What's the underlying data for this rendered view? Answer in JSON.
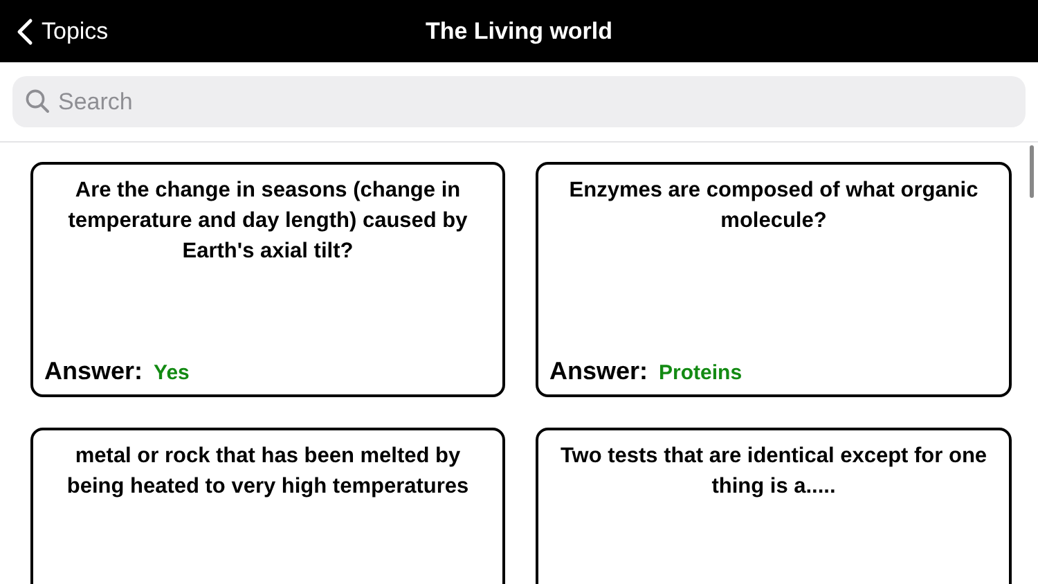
{
  "nav_bar": {
    "back_label": "Topics",
    "title": "The Living world"
  },
  "search": {
    "placeholder": "Search"
  },
  "cards": [
    {
      "question": "Are the change in seasons (change in temperature and day length) caused by Earth's axial tilt?",
      "answer_label": "Answer:",
      "answer": "Yes"
    },
    {
      "question": "Enzymes are composed of what organic molecule?",
      "answer_label": "Answer:",
      "answer": "Proteins"
    },
    {
      "question": "metal or rock that has been melted by being heated to very high temperatures"
    },
    {
      "question": "Two tests that are identical except for one thing is a....."
    }
  ]
}
